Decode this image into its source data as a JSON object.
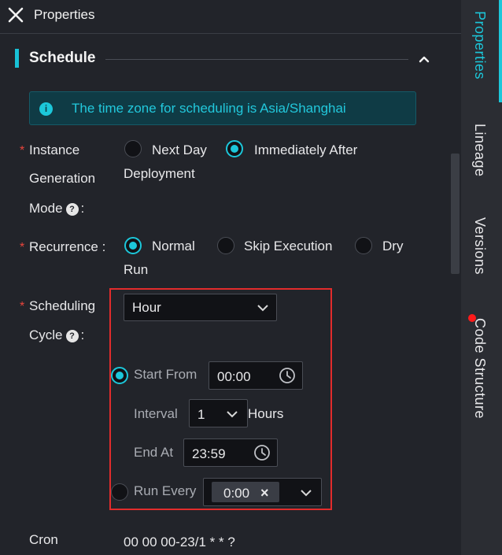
{
  "header": {
    "title": "Properties"
  },
  "section": {
    "title": "Schedule"
  },
  "info": {
    "text": "The time zone for scheduling is Asia/Shanghai"
  },
  "instance_mode": {
    "required": "*",
    "label_line1": "Instance",
    "label_line2": "Generation",
    "label_line3": "Mode",
    "suffix": ":",
    "options": [
      "Next Day",
      "Immediately After",
      "Deployment"
    ],
    "selected": "Immediately After Deployment"
  },
  "recurrence": {
    "required": "*",
    "label": "Recurrence :",
    "options": [
      "Normal",
      "Skip Execution",
      "Dry",
      "Run"
    ],
    "selected": "Normal"
  },
  "scheduling_cycle": {
    "required": "*",
    "label_line1": "Scheduling",
    "label_line2": "Cycle",
    "suffix": ":",
    "value": "Hour",
    "start_from": {
      "label": "Start From",
      "value": "00:00"
    },
    "interval": {
      "label": "Interval",
      "value": "1",
      "unit": "Hours"
    },
    "end_at": {
      "label": "End At",
      "value": "23:59"
    },
    "run_every": {
      "label": "Run Every",
      "tag": "0:00",
      "tag_remove": "×"
    },
    "mode_selected": "Start From"
  },
  "cron": {
    "label": "Cron",
    "value": "00 00 00-23/1 * * ?"
  },
  "sidebar": {
    "tabs": [
      "Properties",
      "Lineage",
      "Versions",
      "Code Structure"
    ],
    "active": "Properties"
  },
  "colors": {
    "accent": "#1cc7da",
    "required": "#e8453c",
    "highlight_frame": "#e22c2c"
  }
}
